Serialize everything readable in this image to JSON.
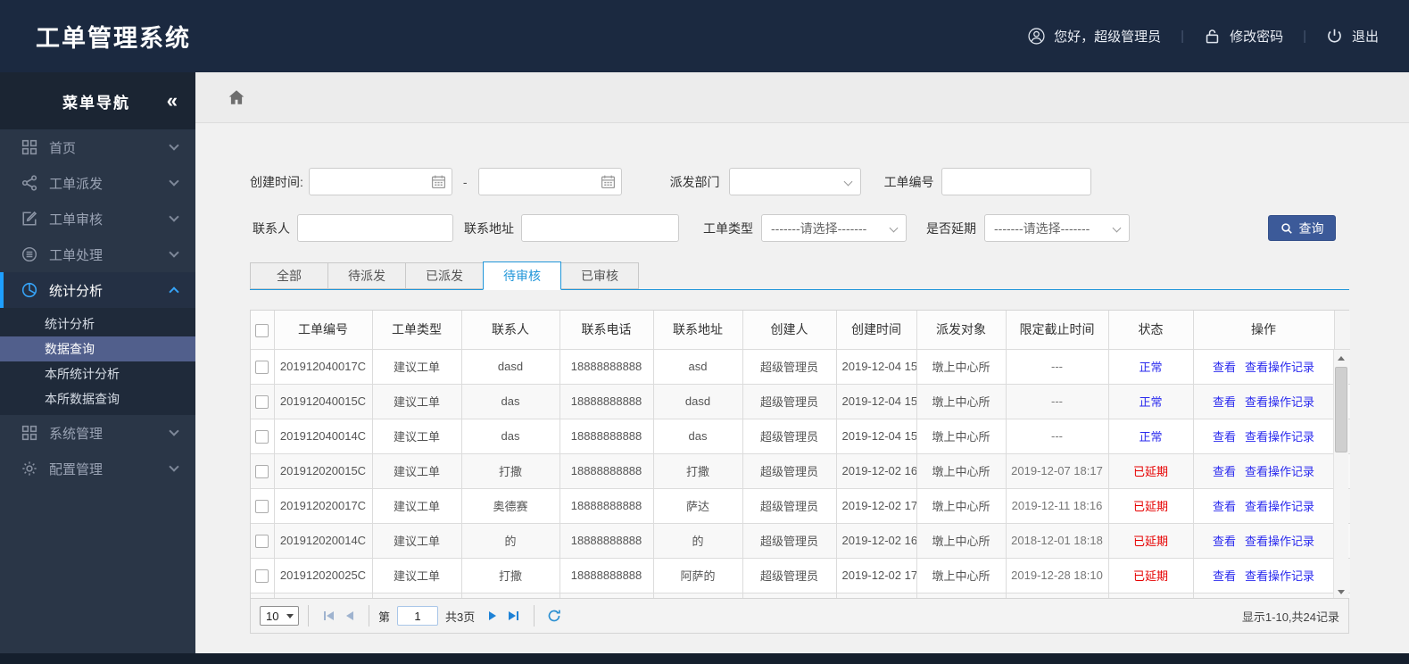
{
  "app": {
    "title": "工单管理系统"
  },
  "topbar": {
    "greeting": "您好，超级管理员",
    "change_password": "修改密码",
    "logout": "退出",
    "separator": "|"
  },
  "sidebar": {
    "title": "菜单导航",
    "collapse_glyph": "«",
    "items": [
      {
        "label": "首页",
        "icon": "grid-icon",
        "active": false
      },
      {
        "label": "工单派发",
        "icon": "share-icon",
        "active": false
      },
      {
        "label": "工单审核",
        "icon": "edit-icon",
        "active": false
      },
      {
        "label": "工单处理",
        "icon": "layers-icon",
        "active": false
      },
      {
        "label": "统计分析",
        "icon": "pie-chart-icon",
        "active": true,
        "children": [
          {
            "label": "统计分析",
            "selected": false
          },
          {
            "label": "数据查询",
            "selected": true
          },
          {
            "label": "本所统计分析",
            "selected": false
          },
          {
            "label": "本所数据查询",
            "selected": false
          }
        ]
      },
      {
        "label": "系统管理",
        "icon": "grid-icon",
        "active": false
      },
      {
        "label": "配置管理",
        "icon": "gear-icon",
        "active": false
      }
    ]
  },
  "filters": {
    "create_time_label": "创建时间:",
    "create_time_start": "",
    "create_time_end": "",
    "range_separator": "-",
    "dept_label": "派发部门",
    "dept_value": "",
    "order_no_label": "工单编号",
    "order_no_value": "",
    "contact_label": "联系人",
    "contact_value": "",
    "address_label": "联系地址",
    "address_value": "",
    "type_label": "工单类型",
    "type_value": "-------请选择-------",
    "delay_label": "是否延期",
    "delay_value": "-------请选择-------",
    "search_label": "查询"
  },
  "tabs": [
    {
      "label": "全部",
      "active": false
    },
    {
      "label": "待派发",
      "active": false
    },
    {
      "label": "已派发",
      "active": false
    },
    {
      "label": "待审核",
      "active": true
    },
    {
      "label": "已审核",
      "active": false
    }
  ],
  "table": {
    "headers": [
      "工单编号",
      "工单类型",
      "联系人",
      "联系电话",
      "联系地址",
      "创建人",
      "创建时间",
      "派发对象",
      "限定截止时间",
      "状态",
      "操作"
    ],
    "action_labels": [
      "查看",
      "查看操作记录"
    ],
    "rows": [
      {
        "order_no": "201912040017C",
        "type": "建议工单",
        "contact": "dasd",
        "phone": "18888888888",
        "address": "asd",
        "creator": "超级管理员",
        "created": "2019-12-04 15",
        "target": "墩上中心所",
        "deadline": "---",
        "status": "正常",
        "status_color": "blue"
      },
      {
        "order_no": "201912040015C",
        "type": "建议工单",
        "contact": "das",
        "phone": "18888888888",
        "address": "dasd",
        "creator": "超级管理员",
        "created": "2019-12-04 15",
        "target": "墩上中心所",
        "deadline": "---",
        "status": "正常",
        "status_color": "blue"
      },
      {
        "order_no": "201912040014C",
        "type": "建议工单",
        "contact": "das",
        "phone": "18888888888",
        "address": "das",
        "creator": "超级管理员",
        "created": "2019-12-04 15",
        "target": "墩上中心所",
        "deadline": "---",
        "status": "正常",
        "status_color": "blue"
      },
      {
        "order_no": "201912020015C",
        "type": "建议工单",
        "contact": "打撒",
        "phone": "18888888888",
        "address": "打撒",
        "creator": "超级管理员",
        "created": "2019-12-02 16",
        "target": "墩上中心所",
        "deadline": "2019-12-07 18:17",
        "status": "已延期",
        "status_color": "red"
      },
      {
        "order_no": "201912020017C",
        "type": "建议工单",
        "contact": "奥德赛",
        "phone": "18888888888",
        "address": "萨达",
        "creator": "超级管理员",
        "created": "2019-12-02 17",
        "target": "墩上中心所",
        "deadline": "2019-12-11 18:16",
        "status": "已延期",
        "status_color": "red"
      },
      {
        "order_no": "201912020014C",
        "type": "建议工单",
        "contact": "的",
        "phone": "18888888888",
        "address": "的",
        "creator": "超级管理员",
        "created": "2019-12-02 16",
        "target": "墩上中心所",
        "deadline": "2018-12-01 18:18",
        "status": "已延期",
        "status_color": "red"
      },
      {
        "order_no": "201912020025C",
        "type": "建议工单",
        "contact": "打撒",
        "phone": "18888888888",
        "address": "阿萨的",
        "creator": "超级管理员",
        "created": "2019-12-02 17",
        "target": "墩上中心所",
        "deadline": "2019-12-28 18:10",
        "status": "已延期",
        "status_color": "red"
      }
    ]
  },
  "pagination": {
    "page_size": "10",
    "page_prefix": "第",
    "current_page": "1",
    "total_pages": "共3页",
    "summary": "显示1-10,共24记录"
  },
  "colors": {
    "header_bg": "#1b2940",
    "sidebar_bg": "#2a3647",
    "accent_blue": "#1e9fff",
    "tab_blue": "#2196d9",
    "link_blue": "#2b2bee",
    "status_normal": "#2b2bee",
    "status_delayed": "#e60000",
    "search_button_blue": "#3c5a99",
    "submenu_selected": "#515f8c"
  }
}
